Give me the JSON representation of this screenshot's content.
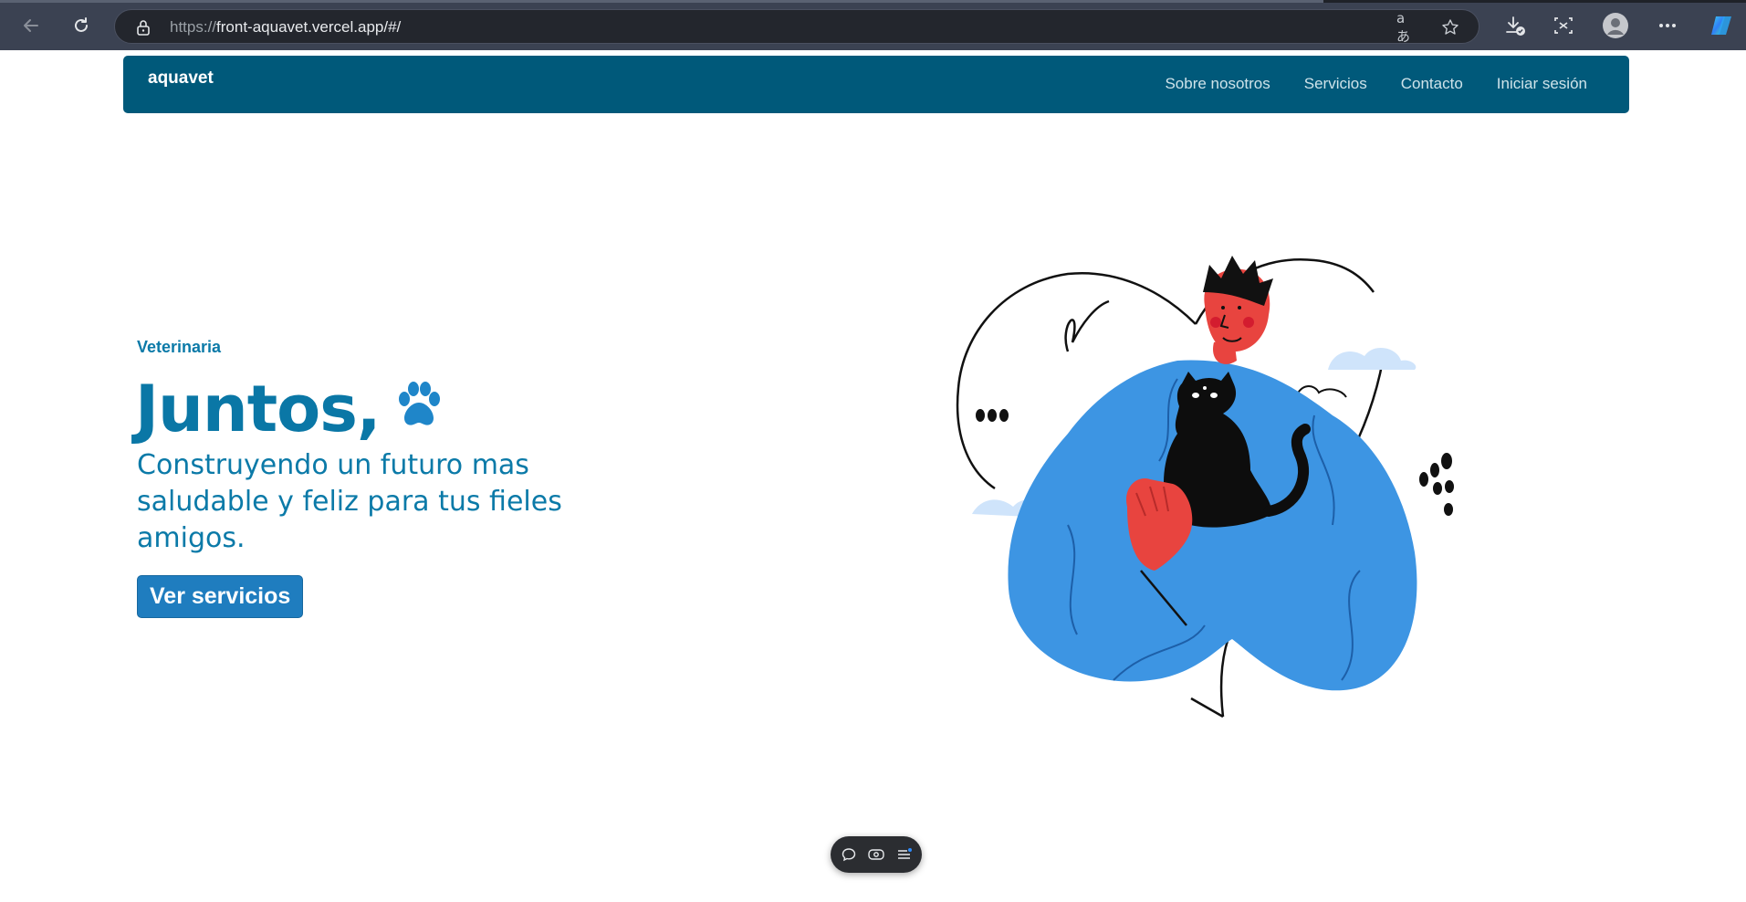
{
  "browser": {
    "url_scheme": "https://",
    "url_host_path": "front-aquavet.vercel.app/#/",
    "icons": [
      "back-icon",
      "refresh-icon",
      "lock-icon",
      "translate-icon",
      "star-icon",
      "downloads-icon",
      "screenshot-icon",
      "profile-icon",
      "more-icon",
      "copilot-icon"
    ],
    "translate_glyph": "aあ"
  },
  "site": {
    "brand": "aquavet",
    "nav": [
      "Sobre nosotros",
      "Servicios",
      "Contacto",
      "Iniciar sesión"
    ],
    "nav_color": "#00597a"
  },
  "hero": {
    "eyebrow": "Veterinaria",
    "title": "Juntos,",
    "title_icon": "paw-icon",
    "subtitle": "Construyendo un futuro mas saludable y feliz para tus fieles amigos.",
    "cta": "Ver servicios",
    "accent": "#0a77a6",
    "cta_color": "#1f7dbf"
  },
  "floating_toolbar": {
    "icons": [
      "comment-icon",
      "eye-icon",
      "menu-icon"
    ]
  }
}
